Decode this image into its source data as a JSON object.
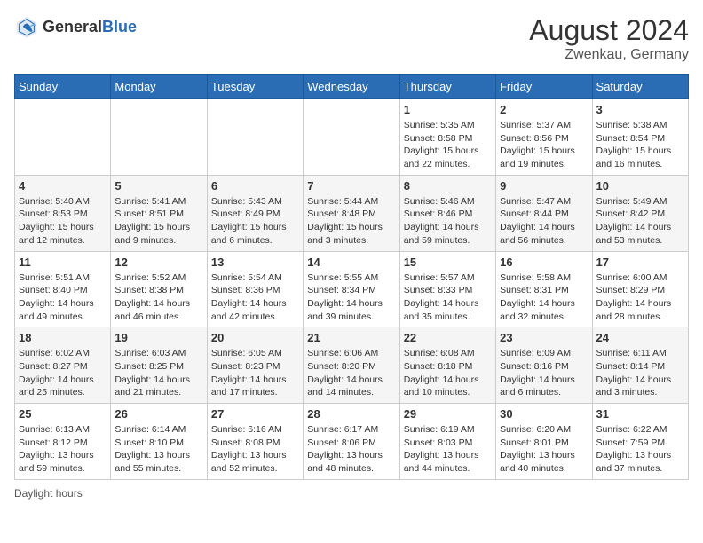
{
  "header": {
    "logo_general": "General",
    "logo_blue": "Blue",
    "month_year": "August 2024",
    "location": "Zwenkau, Germany"
  },
  "weekdays": [
    "Sunday",
    "Monday",
    "Tuesday",
    "Wednesday",
    "Thursday",
    "Friday",
    "Saturday"
  ],
  "footer": {
    "daylight_label": "Daylight hours"
  },
  "weeks": [
    [
      {
        "day": "",
        "info": ""
      },
      {
        "day": "",
        "info": ""
      },
      {
        "day": "",
        "info": ""
      },
      {
        "day": "",
        "info": ""
      },
      {
        "day": "1",
        "info": "Sunrise: 5:35 AM\nSunset: 8:58 PM\nDaylight: 15 hours and 22 minutes."
      },
      {
        "day": "2",
        "info": "Sunrise: 5:37 AM\nSunset: 8:56 PM\nDaylight: 15 hours and 19 minutes."
      },
      {
        "day": "3",
        "info": "Sunrise: 5:38 AM\nSunset: 8:54 PM\nDaylight: 15 hours and 16 minutes."
      }
    ],
    [
      {
        "day": "4",
        "info": "Sunrise: 5:40 AM\nSunset: 8:53 PM\nDaylight: 15 hours and 12 minutes."
      },
      {
        "day": "5",
        "info": "Sunrise: 5:41 AM\nSunset: 8:51 PM\nDaylight: 15 hours and 9 minutes."
      },
      {
        "day": "6",
        "info": "Sunrise: 5:43 AM\nSunset: 8:49 PM\nDaylight: 15 hours and 6 minutes."
      },
      {
        "day": "7",
        "info": "Sunrise: 5:44 AM\nSunset: 8:48 PM\nDaylight: 15 hours and 3 minutes."
      },
      {
        "day": "8",
        "info": "Sunrise: 5:46 AM\nSunset: 8:46 PM\nDaylight: 14 hours and 59 minutes."
      },
      {
        "day": "9",
        "info": "Sunrise: 5:47 AM\nSunset: 8:44 PM\nDaylight: 14 hours and 56 minutes."
      },
      {
        "day": "10",
        "info": "Sunrise: 5:49 AM\nSunset: 8:42 PM\nDaylight: 14 hours and 53 minutes."
      }
    ],
    [
      {
        "day": "11",
        "info": "Sunrise: 5:51 AM\nSunset: 8:40 PM\nDaylight: 14 hours and 49 minutes."
      },
      {
        "day": "12",
        "info": "Sunrise: 5:52 AM\nSunset: 8:38 PM\nDaylight: 14 hours and 46 minutes."
      },
      {
        "day": "13",
        "info": "Sunrise: 5:54 AM\nSunset: 8:36 PM\nDaylight: 14 hours and 42 minutes."
      },
      {
        "day": "14",
        "info": "Sunrise: 5:55 AM\nSunset: 8:34 PM\nDaylight: 14 hours and 39 minutes."
      },
      {
        "day": "15",
        "info": "Sunrise: 5:57 AM\nSunset: 8:33 PM\nDaylight: 14 hours and 35 minutes."
      },
      {
        "day": "16",
        "info": "Sunrise: 5:58 AM\nSunset: 8:31 PM\nDaylight: 14 hours and 32 minutes."
      },
      {
        "day": "17",
        "info": "Sunrise: 6:00 AM\nSunset: 8:29 PM\nDaylight: 14 hours and 28 minutes."
      }
    ],
    [
      {
        "day": "18",
        "info": "Sunrise: 6:02 AM\nSunset: 8:27 PM\nDaylight: 14 hours and 25 minutes."
      },
      {
        "day": "19",
        "info": "Sunrise: 6:03 AM\nSunset: 8:25 PM\nDaylight: 14 hours and 21 minutes."
      },
      {
        "day": "20",
        "info": "Sunrise: 6:05 AM\nSunset: 8:23 PM\nDaylight: 14 hours and 17 minutes."
      },
      {
        "day": "21",
        "info": "Sunrise: 6:06 AM\nSunset: 8:20 PM\nDaylight: 14 hours and 14 minutes."
      },
      {
        "day": "22",
        "info": "Sunrise: 6:08 AM\nSunset: 8:18 PM\nDaylight: 14 hours and 10 minutes."
      },
      {
        "day": "23",
        "info": "Sunrise: 6:09 AM\nSunset: 8:16 PM\nDaylight: 14 hours and 6 minutes."
      },
      {
        "day": "24",
        "info": "Sunrise: 6:11 AM\nSunset: 8:14 PM\nDaylight: 14 hours and 3 minutes."
      }
    ],
    [
      {
        "day": "25",
        "info": "Sunrise: 6:13 AM\nSunset: 8:12 PM\nDaylight: 13 hours and 59 minutes."
      },
      {
        "day": "26",
        "info": "Sunrise: 6:14 AM\nSunset: 8:10 PM\nDaylight: 13 hours and 55 minutes."
      },
      {
        "day": "27",
        "info": "Sunrise: 6:16 AM\nSunset: 8:08 PM\nDaylight: 13 hours and 52 minutes."
      },
      {
        "day": "28",
        "info": "Sunrise: 6:17 AM\nSunset: 8:06 PM\nDaylight: 13 hours and 48 minutes."
      },
      {
        "day": "29",
        "info": "Sunrise: 6:19 AM\nSunset: 8:03 PM\nDaylight: 13 hours and 44 minutes."
      },
      {
        "day": "30",
        "info": "Sunrise: 6:20 AM\nSunset: 8:01 PM\nDaylight: 13 hours and 40 minutes."
      },
      {
        "day": "31",
        "info": "Sunrise: 6:22 AM\nSunset: 7:59 PM\nDaylight: 13 hours and 37 minutes."
      }
    ]
  ]
}
